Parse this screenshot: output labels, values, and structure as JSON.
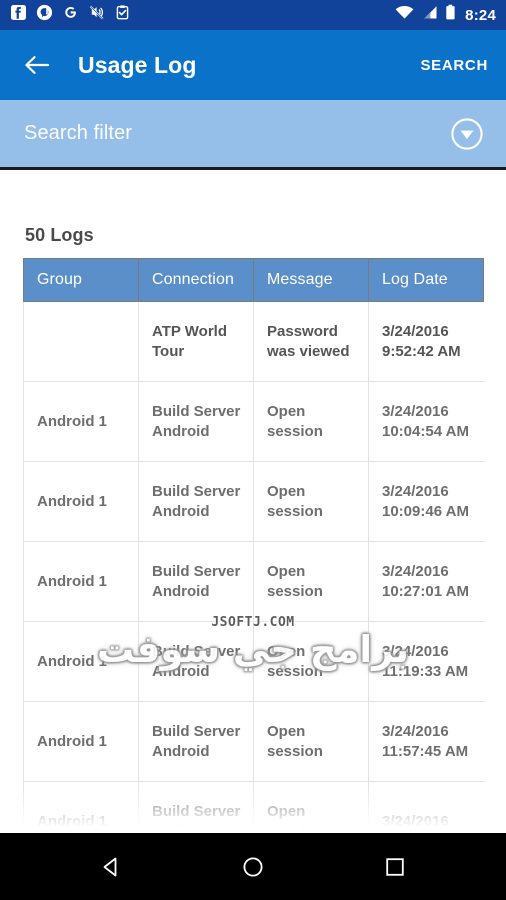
{
  "status_bar": {
    "left_icons": [
      {
        "name": "facebook-icon",
        "label": "Facebook"
      },
      {
        "name": "messenger-icon",
        "label": "Messenger"
      },
      {
        "name": "google-icon",
        "label": "Google"
      },
      {
        "name": "mute-icon",
        "label": "Sound off"
      },
      {
        "name": "clipboard-check-icon",
        "label": "Clipboard"
      }
    ],
    "right_icons": [
      {
        "name": "wifi-icon",
        "label": "Wi-Fi"
      },
      {
        "name": "signal-icon",
        "label": "Signal"
      },
      {
        "name": "battery-icon",
        "label": "Battery"
      }
    ],
    "clock": "8:24",
    "background_color": "#12439B"
  },
  "app_bar": {
    "back_label": "Back",
    "title": "Usage Log",
    "search_label": "SEARCH",
    "background_color": "#0A72C8"
  },
  "filter_bar": {
    "placeholder": "Search filter",
    "value": "",
    "expand_label": "Expand filter",
    "background_color": "#95BFE8"
  },
  "main": {
    "logs_count": "50 Logs",
    "table": {
      "headers": [
        "Group",
        "Connection",
        "Message",
        "Log Date"
      ],
      "header_background": "#5B8FC9",
      "rows": [
        {
          "group": "",
          "connection": "ATP World Tour",
          "message": "Password was viewed",
          "log_date": "3/24/2016 9:52:42 AM"
        },
        {
          "group": "Android 1",
          "connection": "Build Server Android",
          "message": "Open session",
          "log_date": "3/24/2016 10:04:54 AM"
        },
        {
          "group": "Android 1",
          "connection": "Build Server Android",
          "message": "Open session",
          "log_date": "3/24/2016 10:09:46 AM"
        },
        {
          "group": "Android 1",
          "connection": "Build Server Android",
          "message": "Open session",
          "log_date": "3/24/2016 10:27:01 AM"
        },
        {
          "group": "Android 1",
          "connection": "Build Server Android",
          "message": "Open session",
          "log_date": "3/24/2016 11:19:33 AM"
        },
        {
          "group": "Android 1",
          "connection": "Build Server Android",
          "message": "Open session",
          "log_date": "3/24/2016 11:57:45 AM"
        },
        {
          "group": "Android 1",
          "connection": "Build Server Android",
          "message": "Open session",
          "log_date": "3/24/2016"
        }
      ]
    }
  },
  "watermark": {
    "url": "JSOFTJ.COM",
    "arabic": "برامج جي سوفت"
  },
  "navigation_bar": {
    "back_label": "Back",
    "home_label": "Home",
    "recents_label": "Recent apps",
    "background_color": "#000000"
  }
}
